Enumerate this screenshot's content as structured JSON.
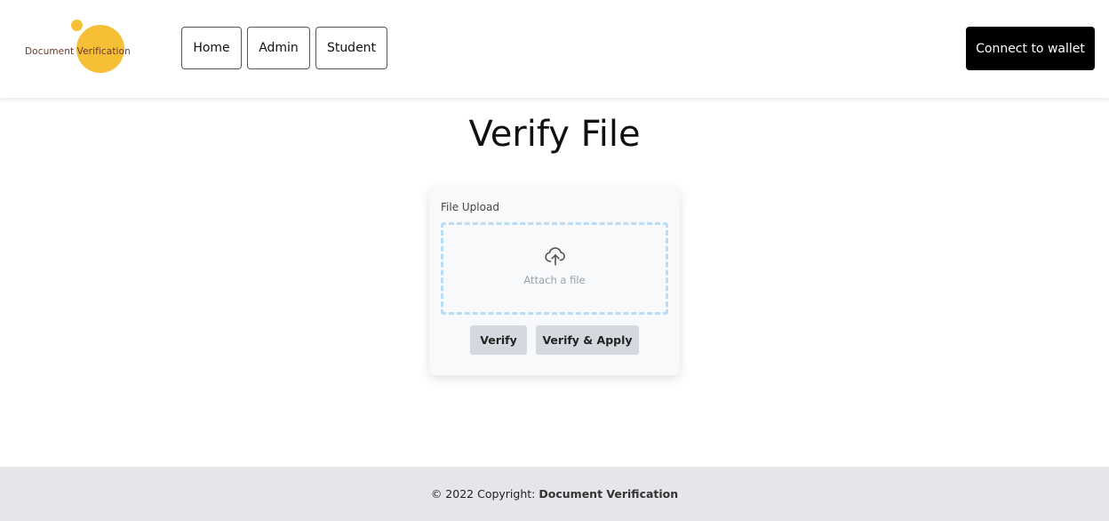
{
  "header": {
    "logo_text": "Document Verification",
    "logo_color": "#f7bf35",
    "nav": {
      "home": "Home",
      "admin": "Admin",
      "student": "Student"
    },
    "wallet_button": "Connect to wallet"
  },
  "main": {
    "title": "Verify File",
    "upload": {
      "label": "File Upload",
      "dropzone_text": "Attach a file",
      "icon": "cloud-upload-icon",
      "border_color": "#bcdcf4"
    },
    "buttons": {
      "verify": "Verify",
      "verify_apply": "Verify & Apply"
    }
  },
  "footer": {
    "copyright": "© 2022 Copyright:",
    "brand": "Document Verification"
  }
}
